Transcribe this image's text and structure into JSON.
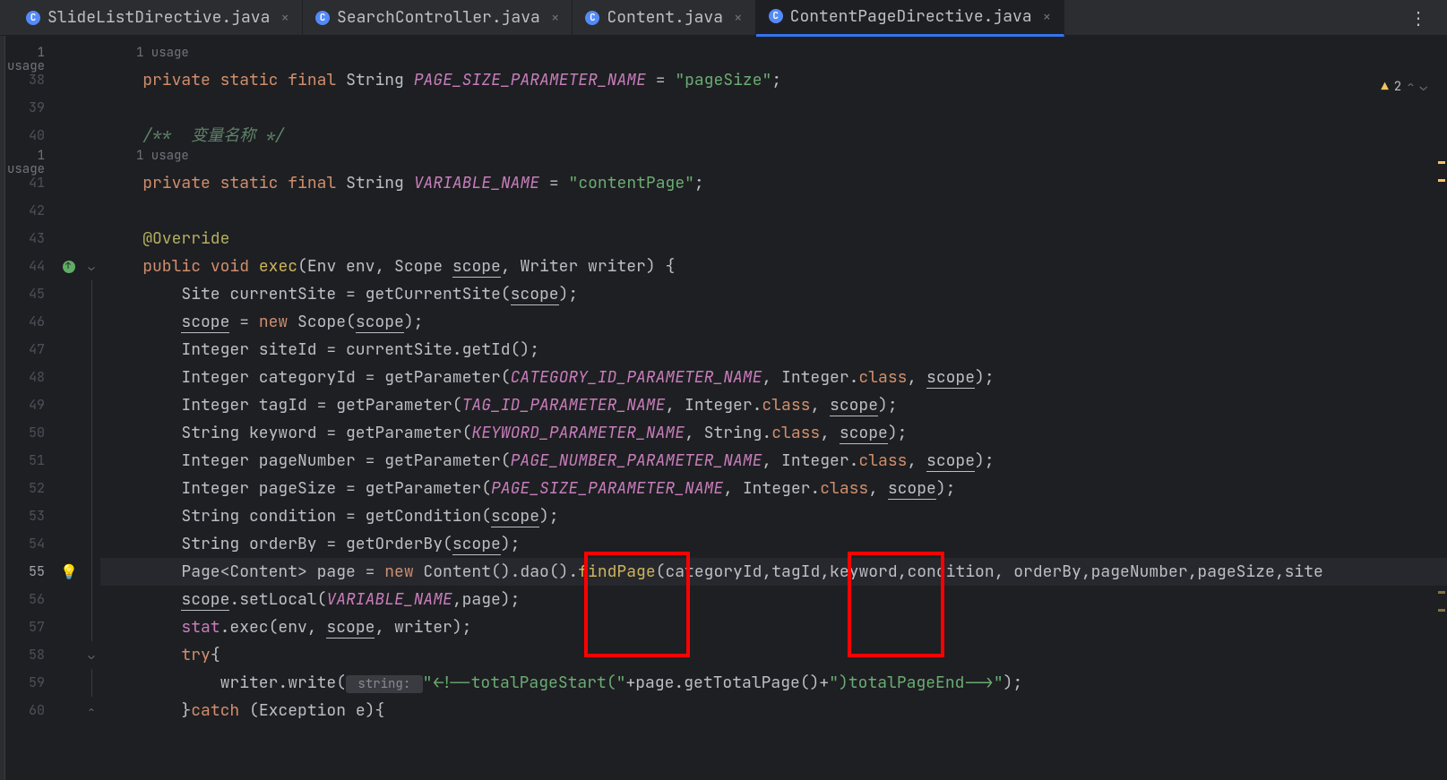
{
  "tabs": [
    {
      "label": "SlideListDirective.java",
      "active": false
    },
    {
      "label": "SearchController.java",
      "active": false
    },
    {
      "label": "Content.java",
      "active": false
    },
    {
      "label": "ContentPageDirective.java",
      "active": true
    }
  ],
  "warning_count": "2",
  "gutter": {
    "lines": [
      "38",
      "39",
      "40",
      "",
      "41",
      "42",
      "43",
      "44",
      "45",
      "46",
      "47",
      "48",
      "49",
      "50",
      "51",
      "52",
      "53",
      "54",
      "55",
      "56",
      "57",
      "58",
      "59",
      "60"
    ],
    "active": "55",
    "usage_above": "1 usage",
    "usage_mid": "1 usage"
  },
  "code": {
    "l38_a": "private",
    "l38_b": "static",
    "l38_c": "final",
    "l38_d": "String",
    "l38_e": "PAGE_SIZE_PARAMETER_NAME",
    "l38_f": "= ",
    "l38_g": "\"pageSize\"",
    "l38_h": ";",
    "l40_a": "/**  变量名称 */",
    "l41_a": "private",
    "l41_b": "static",
    "l41_c": "final",
    "l41_d": "String",
    "l41_e": "VARIABLE_NAME",
    "l41_f": "= ",
    "l41_g": "\"contentPage\"",
    "l41_h": ";",
    "l43_a": "@Override",
    "l44_a": "public",
    "l44_b": "void",
    "l44_c": "exec",
    "l44_d": "(Env env, Scope ",
    "l44_e": "scope",
    "l44_f": ", Writer writer) {",
    "l45_a": "Site currentSite = getCurrentSite(",
    "l45_b": "scope",
    "l45_c": ");",
    "l46_a": "scope",
    "l46_b": " = ",
    "l46_c": "new",
    "l46_d": " Scope(",
    "l46_e": "scope",
    "l46_f": ");",
    "l47_a": "Integer siteId = currentSite.getId();",
    "l48_a": "Integer categoryId = getParameter(",
    "l48_b": "CATEGORY_ID_PARAMETER_NAME",
    "l48_c": ", Integer.",
    "l48_d": "class",
    "l48_e": ", ",
    "l48_f": "scope",
    "l48_g": ");",
    "l49_a": "Integer tagId = getParameter(",
    "l49_b": "TAG_ID_PARAMETER_NAME",
    "l49_c": ", Integer.",
    "l49_d": "class",
    "l49_e": ", ",
    "l49_f": "scope",
    "l49_g": ");",
    "l50_a": "String keyword = getParameter(",
    "l50_b": "KEYWORD_PARAMETER_NAME",
    "l50_c": ", String.",
    "l50_d": "class",
    "l50_e": ", ",
    "l50_f": "scope",
    "l50_g": ");",
    "l51_a": "Integer pageNumber = getParameter(",
    "l51_b": "PAGE_NUMBER_PARAMETER_NAME",
    "l51_c": ", Integer.",
    "l51_d": "class",
    "l51_e": ", ",
    "l51_f": "scope",
    "l51_g": ");",
    "l52_a": "Integer pageSize = getParameter(",
    "l52_b": "PAGE_SIZE_PARAMETER_NAME",
    "l52_c": ", Integer.",
    "l52_d": "class",
    "l52_e": ", ",
    "l52_f": "scope",
    "l52_g": ");",
    "l53_a": "String condition = getCondition(",
    "l53_b": "scope",
    "l53_c": ");",
    "l54_a": "String orderBy = getOrderBy(",
    "l54_b": "scope",
    "l54_c": ");",
    "l55_a": "Page<Content> page = ",
    "l55_b": "new",
    "l55_c": " Content().dao().",
    "l55_d": "findPage",
    "l55_e": "(categoryId,tagId,keyword,condition, orderBy,pageNumber,pageSize,site",
    "l56_a": "scope",
    "l56_b": ".setLocal(",
    "l56_c": "VARIABLE_NAME",
    "l56_d": ",page);",
    "l57_a": "stat",
    "l57_b": ".exec(env, ",
    "l57_c": "scope",
    "l57_d": ", writer);",
    "l58_a": "try",
    "l58_b": "{",
    "l59_a": "writer.write(",
    "l59_b": " string: ",
    "l59_c": "\"<!--totalPageStart(\"",
    "l59_d": "+page.getTotalPage()+",
    "l59_e": "\")totalPageEnd-->\"",
    "l59_f": ");",
    "l60_a": "}",
    "l60_b": "catch",
    "l60_c": " (Exception e){"
  }
}
